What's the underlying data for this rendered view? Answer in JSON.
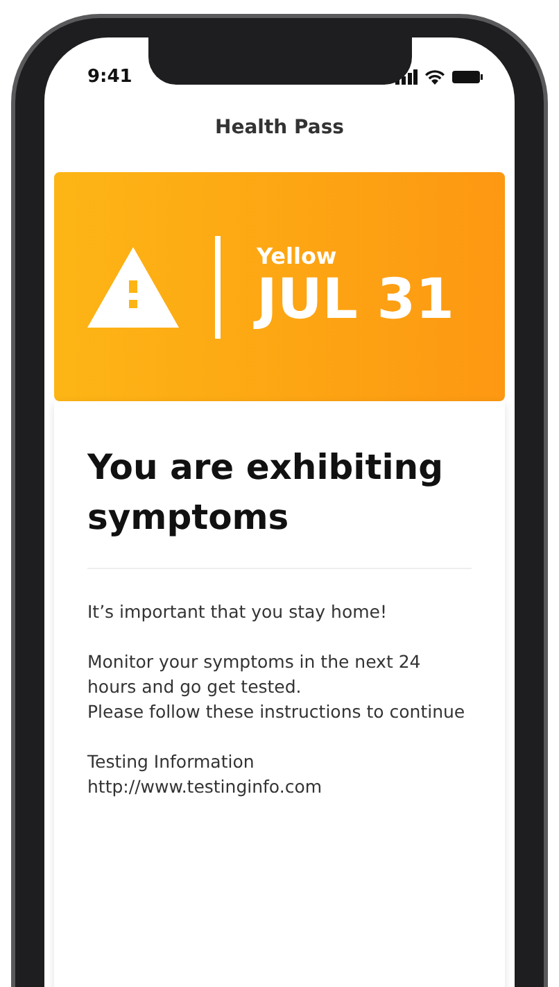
{
  "status_bar": {
    "time": "9:41"
  },
  "header": {
    "title": "Health Pass"
  },
  "banner": {
    "status": "Yellow",
    "date": "JUL 31",
    "color": "#fdb515"
  },
  "message": {
    "title": "You are exhibiting symptoms",
    "blocks": [
      {
        "lines": [
          {
            "kind": "text",
            "text": "It’s important that you stay home!"
          }
        ]
      },
      {
        "lines": [
          {
            "kind": "text",
            "text": "Monitor your symptoms in the next 24 hours and go get tested."
          },
          {
            "kind": "text",
            "text": "Please follow these instructions to continue"
          }
        ]
      },
      {
        "lines": [
          {
            "kind": "text",
            "text": "Testing Information"
          },
          {
            "kind": "link",
            "text": "http://www.testinginfo.com"
          }
        ]
      }
    ]
  }
}
